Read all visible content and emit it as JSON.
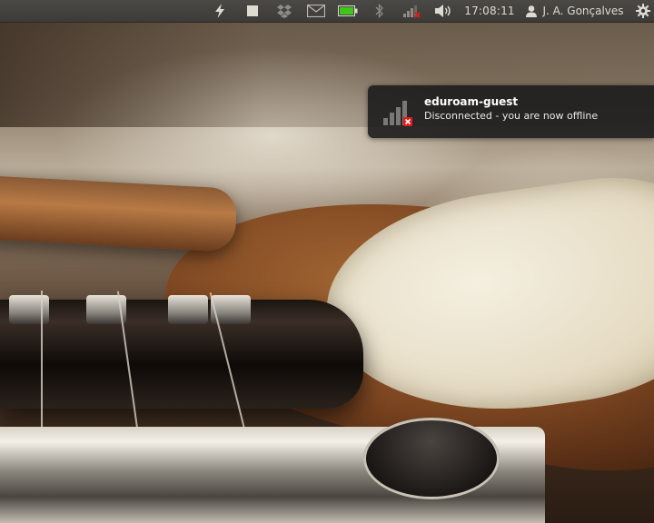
{
  "top_panel": {
    "clock": "17:08:11",
    "username": "J. A. Gonçalves",
    "indicators": [
      {
        "name": "power-icon"
      },
      {
        "name": "stop-icon"
      },
      {
        "name": "dropbox-icon"
      },
      {
        "name": "mail-icon"
      },
      {
        "name": "battery-icon"
      },
      {
        "name": "bluetooth-icon"
      },
      {
        "name": "network-disconnected-icon"
      },
      {
        "name": "volume-icon"
      },
      {
        "name": "user-icon"
      },
      {
        "name": "gear-icon"
      }
    ],
    "battery_level": 1.0,
    "colors": {
      "panel_bg": "#3c3b37",
      "panel_text": "#dfdbd2",
      "battery_green": "#3ec619",
      "error_red": "#e01b1b"
    }
  },
  "notification": {
    "title": "eduroam-guest",
    "body": "Disconnected - you are now offline",
    "icon": "wifi-signal-disconnected-icon"
  }
}
